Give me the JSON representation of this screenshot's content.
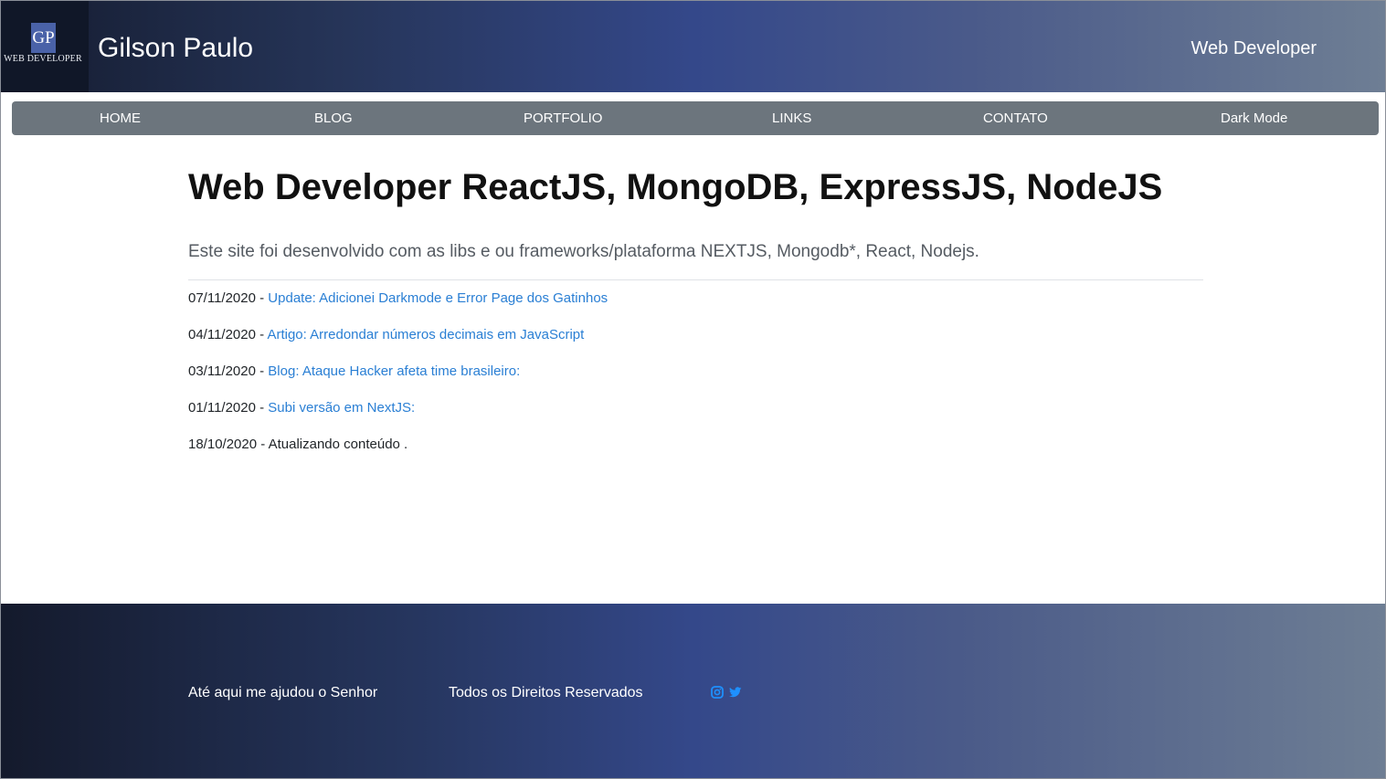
{
  "header": {
    "logo_mark": "GP",
    "logo_subtitle": "WEB DEVELOPER",
    "site_title": "Gilson Paulo",
    "tagline": "Web Developer"
  },
  "nav": {
    "items": [
      {
        "label": "HOME"
      },
      {
        "label": "BLOG"
      },
      {
        "label": "PORTFOLIO"
      },
      {
        "label": "LINKS"
      },
      {
        "label": "CONTATO"
      },
      {
        "label": "Dark Mode"
      }
    ]
  },
  "main": {
    "title": "Web Developer ReactJS, MongoDB, ExpressJS, NodeJS",
    "lead": "Este site foi desenvolvido com as libs e ou frameworks/plataforma NEXTJS, Mongodb*, React, Nodejs.",
    "updates": [
      {
        "date": "07/11/2020 -",
        "text": "Update: Adicionei Darkmode e Error Page dos Gatinhos",
        "is_link": true
      },
      {
        "date": "04/11/2020 -",
        "text": "Artigo: Arredondar números decimais em JavaScript",
        "is_link": true
      },
      {
        "date": "03/11/2020 -",
        "text": "Blog: Ataque Hacker afeta time brasileiro:",
        "is_link": true
      },
      {
        "date": "01/11/2020 -",
        "text": "Subi versão em NextJS:",
        "is_link": true
      },
      {
        "date": "18/10/2020 -",
        "text": "Atualizando conteúdo .",
        "is_link": false
      }
    ]
  },
  "footer": {
    "text_left": "Até aqui me ajudou o Senhor",
    "text_center": "Todos os Direitos Reservados",
    "social": [
      {
        "icon": "instagram-icon"
      },
      {
        "icon": "twitter-icon"
      }
    ]
  },
  "colors": {
    "nav_bg": "#6c757d",
    "link": "#2a7fd4",
    "social_icon": "#1e90ff"
  }
}
